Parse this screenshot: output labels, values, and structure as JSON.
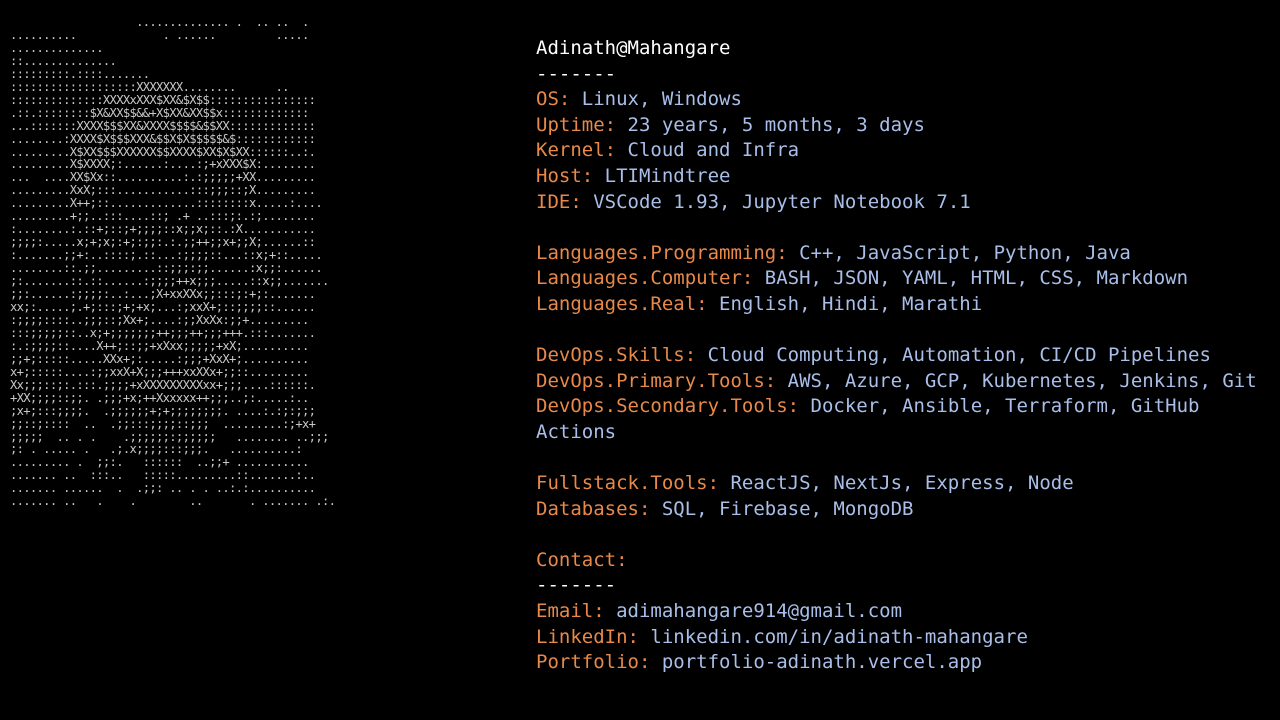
{
  "ascii_art": [
    "                   .............. .  .. ..  .",
    "..........             . ......         .....",
    "..............",
    "::..............",
    ":::::::::.::::.......",
    ":::::::::::::::::::XXXXXXX........      ..",
    "::::::::::::::XXXXxXXX$XX&$X$$::::::::::::::::",
    ".::.::::::::$X&XX$$&&+X$XX&XX$$x:::::::::::::",
    "...:::::::XXXX$$$XX&XXXX$$$$&$$XX:::::::::::::",
    "........:XXXX$X$$$XXX&$$X$X$$$$$&$::::::::::::",
    ".........X$XX$$$XXXXXX$$XXXX$XX$X$XX::::::..:.",
    ".........X$XXXX;:......:....:;+xXXX$X:........",
    "...  ....XX$Xx::..........:.:;;;;;+XX.........",
    ".........XxX;:::...........:::;;;::;X.........",
    ".........X++;::.............::::::::x.....:....",
    ".........+;;..:::....::; .+ ..:::;:.:;........",
    ":........:.::+;::;+;;;;::x;;x;::.:X...........",
    ";;;;:.....x;+;x;:+;:;;:.:.;;++;;x+;;X;......::",
    ":.......;;+:..::::;.::...:;;;;::...::x;+::.....",
    "........::.;;.........::;;;:;;......:x;;:......",
    ";:.......::.::......:;;;;++x;;;.....::x;;.......",
    ";;:......:;;;;:..:...;X+xxXXx;;:::;:+;:.......",
    "xx;:.....;.+;:::;+;+x;...:;xxX+;::;;;;::......",
    ":;;;;::::..;;;::;Xx+;....:;;XxXx:;;+.........",
    ":::;;;;;::..x;+;;;;;;;++;;;++;;;+++.:::.......",
    ":.:;;;;::....X++;::;;+xXxx;;;;;+xX;..........",
    ";;+;:::::.....XXx+;:.....:;;;+XxX+;..........",
    "x+;:::::....:;;xxX+X;;;+++xxXXx+;;::.........",
    "Xx;;;::;:.:::.;;;;+xXXXXXXXXXxx+;;;....::::::.",
    "+XX;;;;::;;. .;;;+x;++Xxxxxx++;;;..;:.....:..",
    ";x+;:::;;;;.  .;;;;;;+;+;;;;;;;;. ....:.:;:;;;",
    ";;::;::::  ..  .;;:::;;;;::;;;  .........:;+x+",
    ";;;;;  .. . .    .;;;;;;:;;;;;;   ........ ..;;;",
    ";: . ..... .   .;.x;;;;:::;;;.   ..........:",
    "......... .  ;;:.   ::::::  ..;;+ ...........",
    "....... ..  :::..   :::::.........::.......:..",
    "....... ......  .  .;;: .. . . ..:.:..........",
    "....... ..   .    .        ..       . ....... .:."
  ],
  "header": {
    "user": "Adinath@Mahangare",
    "separator": "-------"
  },
  "system": [
    {
      "key": "OS:",
      "value": " Linux, Windows"
    },
    {
      "key": "Uptime:",
      "value": " 23 years, 5 months, 3 days"
    },
    {
      "key": "Kernel:",
      "value": " Cloud and Infra"
    },
    {
      "key": "Host:",
      "value": " LTIMindtree"
    },
    {
      "key": "IDE:",
      "value": " VSCode 1.93, Jupyter Notebook 7.1"
    }
  ],
  "languages": [
    {
      "key": "Languages.Programming:",
      "value": " C++, JavaScript, Python, Java"
    },
    {
      "key": "Languages.Computer:",
      "value": " BASH, JSON, YAML, HTML, CSS, Markdown"
    },
    {
      "key": "Languages.Real:",
      "value": " English, Hindi, Marathi"
    }
  ],
  "devops": [
    {
      "key": "DevOps.Skills:",
      "value": " Cloud Computing, Automation, CI/CD Pipelines"
    },
    {
      "key": "DevOps.Primary.Tools:",
      "value": " AWS, Azure, GCP, Kubernetes, Jenkins, Git"
    },
    {
      "key": "DevOps.Secondary.Tools:",
      "value": " Docker, Ansible, Terraform, GitHub Actions"
    }
  ],
  "fullstack": [
    {
      "key": "Fullstack.Tools:",
      "value": " ReactJS, NextJs, Express, Node"
    },
    {
      "key": "Databases:",
      "value": " SQL, Firebase, MongoDB"
    }
  ],
  "contact": {
    "title": "Contact:",
    "separator": "-------",
    "items": [
      {
        "key": "Email:",
        "value": " adimahangare914@gmail.com"
      },
      {
        "key": "LinkedIn:",
        "value": " linkedin.com/in/adinath-mahangare"
      },
      {
        "key": "Portfolio:",
        "value": " portfolio-adinath.vercel.app"
      }
    ]
  },
  "colors": {
    "background": "#000000",
    "key": "#e8894a",
    "value": "#a9bfea",
    "header": "#ffffff",
    "ascii": "#c9c9c9"
  }
}
